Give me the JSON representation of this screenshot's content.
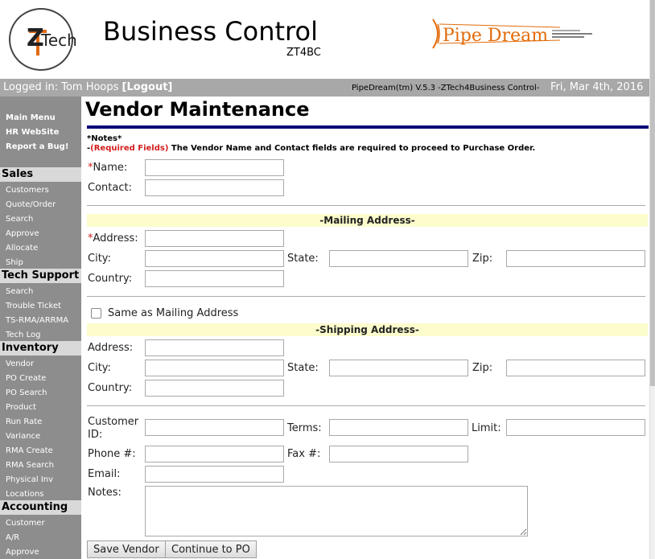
{
  "header": {
    "logo_z": "Z",
    "logo_tech": "Tech",
    "app_title": "Business Control",
    "app_subtitle": "ZT4BC",
    "brand_text": "Pipe Dream",
    "brand_color": "#e26b0a"
  },
  "status": {
    "logged_in_prefix": "Logged in: Tom Hoops",
    "logout_label": "[Logout]",
    "version": "PipeDream(tm) V.5.3 -ZTech4Business Control-",
    "date": "Fri, Mar 4th, 2016"
  },
  "sidebar": {
    "top_links": [
      "Main Menu",
      "HR WebSite",
      "Report a Bug!"
    ],
    "sections": [
      {
        "title": "Sales",
        "items": [
          "Customers",
          "Quote/Order",
          "Search",
          "Approve",
          "Allocate",
          "Ship"
        ]
      },
      {
        "title": "Tech Support",
        "items": [
          "Search",
          "Trouble Ticket",
          "TS-RMA/ARRMA",
          "Tech Log"
        ]
      },
      {
        "title": "Inventory",
        "items": [
          "Vendor",
          "PO Create",
          "PO Search",
          "Product",
          "Run Rate",
          "Variance",
          "RMA Create",
          "RMA Search",
          "Physical Inv",
          "Locations"
        ]
      },
      {
        "title": "Accounting",
        "items": [
          "Customer",
          "A/R",
          "Approve"
        ]
      }
    ]
  },
  "main": {
    "title": "Vendor Maintenance",
    "notes_head": "*Notes*",
    "notes_prefix": "-",
    "required_label": "(Required Fields)",
    "notes_text": " The Vendor Name and Contact fields are required to proceed to Purchase Order.",
    "name_label": "Name:",
    "contact_label": "Contact:",
    "mailing_header": "-Mailing Address-",
    "address_label": "Address:",
    "city_label": "City:",
    "state_label": "State:",
    "zip_label": "Zip:",
    "country_label": "Country:",
    "same_as_mailing": "Same as Mailing Address",
    "shipping_header": "-Shipping Address-",
    "customer_id_label_1": "Customer",
    "customer_id_label_2": "ID:",
    "terms_label": "Terms:",
    "limit_label": "Limit:",
    "phone_label": "Phone #:",
    "fax_label": "Fax #:",
    "email_label": "Email:",
    "notes_label": "Notes:",
    "save_button": "Save Vendor",
    "continue_button": "Continue to PO",
    "required_color": "#d21d1d",
    "band_color": "#fcfccd",
    "rule_color": "#0a0a78"
  }
}
